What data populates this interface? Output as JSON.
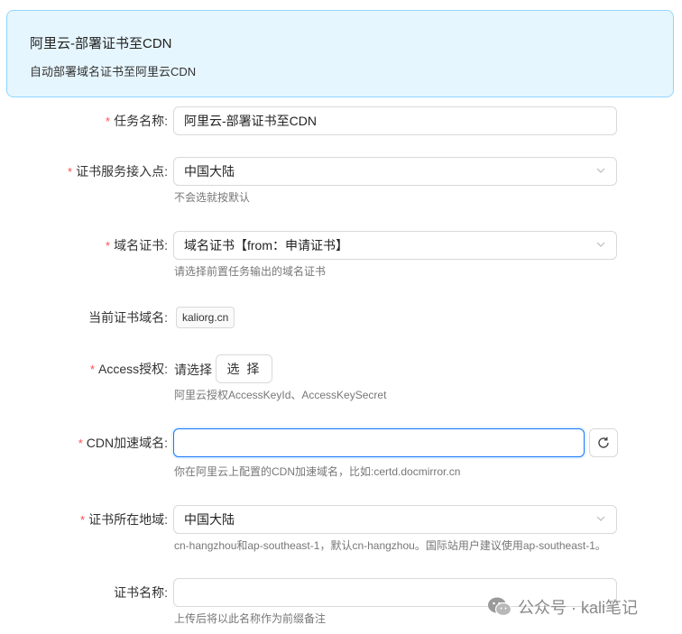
{
  "banner": {
    "title": "阿里云-部署证书至CDN",
    "description": "自动部署域名证书至阿里云CDN"
  },
  "form": {
    "task_name": {
      "label": "任务名称:",
      "value": "阿里云-部署证书至CDN",
      "required": true
    },
    "endpoint": {
      "label": "证书服务接入点:",
      "value": "中国大陆",
      "help": "不会选就按默认",
      "required": true
    },
    "domain_cert": {
      "label": "域名证书:",
      "value": "域名证书【from：申请证书】",
      "help": "请选择前置任务输出的域名证书",
      "required": true
    },
    "current_domain": {
      "label": "当前证书域名:",
      "value": "kaliorg.cn"
    },
    "access": {
      "label": "Access授权:",
      "placeholder_text": "请选择",
      "button": "选 择",
      "help": "阿里云授权AccessKeyId、AccessKeySecret",
      "required": true
    },
    "cdn_domain": {
      "label": "CDN加速域名:",
      "value": "",
      "help": "你在阿里云上配置的CDN加速域名，比如:certd.docmirror.cn",
      "required": true
    },
    "cert_region": {
      "label": "证书所在地域:",
      "value": "中国大陆",
      "help": "cn-hangzhou和ap-southeast-1，默认cn-hangzhou。国际站用户建议使用ap-southeast-1。",
      "required": true
    },
    "cert_name": {
      "label": "证书名称:",
      "value": "",
      "help": "上传后将以此名称作为前缀备注"
    }
  },
  "watermark": {
    "text": "公众号 · kali笔记",
    "icon": "wechat-icon"
  },
  "colors": {
    "accent": "#1677ff",
    "required": "#ff4d4f",
    "banner_bg": "#e6f6fe",
    "banner_border": "#91d5ff"
  }
}
